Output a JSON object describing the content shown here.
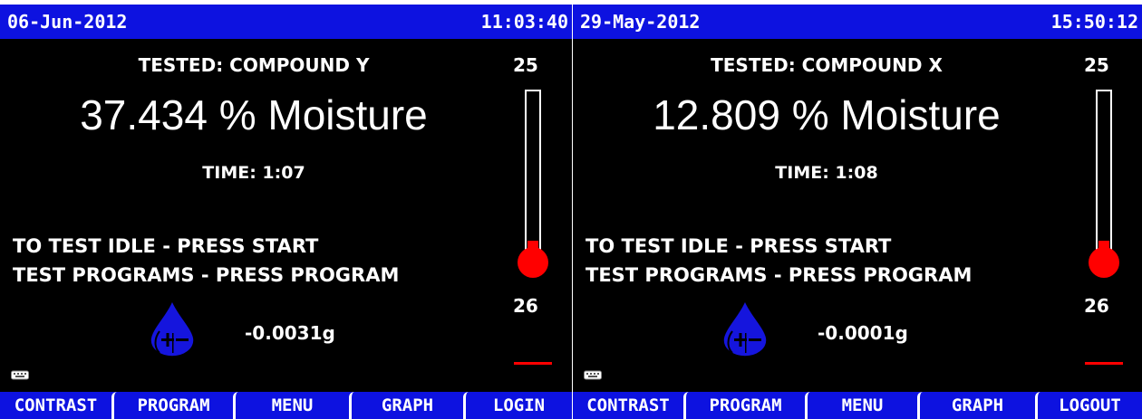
{
  "panels": [
    {
      "header": {
        "date": "06-Jun-2012",
        "time": "11:03:40"
      },
      "tested": "TESTED: COMPOUND Y",
      "reading": "37.434 % Moisture",
      "elapsed": "TIME: 1:07",
      "instructions": [
        "TO TEST IDLE - PRESS START",
        "TEST PROGRAMS - PRESS PROGRAM"
      ],
      "weight": "-0.0031g",
      "temp_scale": {
        "top": "25",
        "bottom": "26"
      },
      "softkeys": [
        "CONTRAST",
        "PROGRAM",
        "MENU",
        "GRAPH",
        "LOGIN"
      ],
      "icons": {
        "drop": "moisture-drop-icon",
        "keyboard": "keyboard-icon",
        "thermometer": "thermometer-icon"
      }
    },
    {
      "header": {
        "date": "29-May-2012",
        "time": "15:50:12"
      },
      "tested": "TESTED: COMPOUND X",
      "reading": "12.809 % Moisture",
      "elapsed": "TIME: 1:08",
      "instructions": [
        "TO TEST IDLE - PRESS START",
        "TEST PROGRAMS - PRESS PROGRAM"
      ],
      "weight": "-0.0001g",
      "temp_scale": {
        "top": "25",
        "bottom": "26"
      },
      "softkeys": [
        "CONTRAST",
        "PROGRAM",
        "MENU",
        "GRAPH",
        "LOGOUT"
      ],
      "icons": {
        "drop": "moisture-drop-icon",
        "keyboard": "keyboard-icon",
        "thermometer": "thermometer-icon"
      }
    }
  ],
  "colors": {
    "header": "#0d12e0",
    "background": "#000000",
    "thermometer": "#ff0000",
    "drop": "#1515dd"
  }
}
